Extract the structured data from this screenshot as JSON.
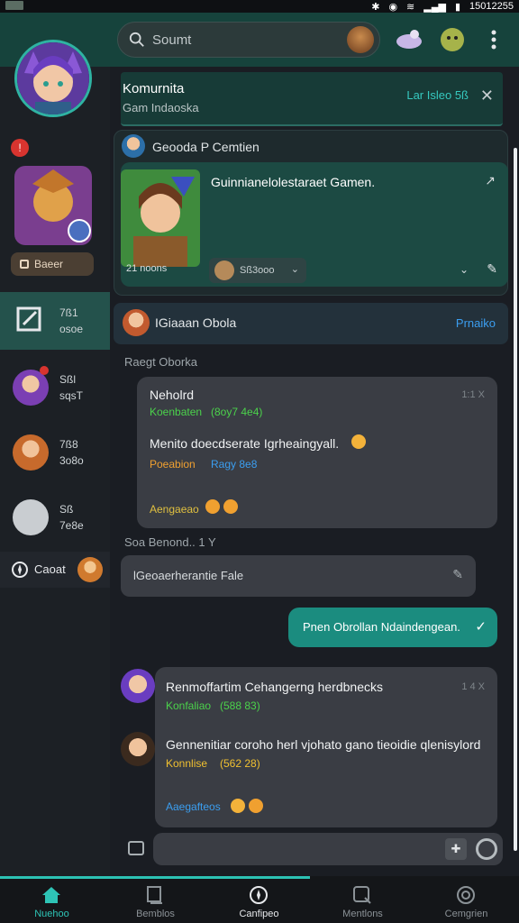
{
  "status": {
    "time": "15012255"
  },
  "search": {
    "placeholder": "Soumt"
  },
  "banner": {
    "title": "Komurnita",
    "subtitle": "Gam Indaoska",
    "link": "Lar Isleo 5ß"
  },
  "card": {
    "author": "Geooda P Cemtien",
    "title": "Guinnianelolestaraet Gamen.",
    "meta": "21 noons",
    "dropdown": "Sß3ooo"
  },
  "pinned": {
    "name": "IGiaaan Obola",
    "action": "Prnaiko"
  },
  "sidebar": {
    "stream_label": "Baeer",
    "items": [
      {
        "line1": "7ß1",
        "line2": "osoe"
      },
      {
        "line1": "Sßl",
        "line2": "sqsT"
      },
      {
        "line1": "7ß8",
        "line2": "3o8o"
      },
      {
        "line1": "Sß",
        "line2": "7e8e"
      }
    ],
    "section_label": "Caoat"
  },
  "messages": {
    "group1_header": "Raegt Oborka",
    "msg1": {
      "title": "Neholrd",
      "time": "1:1 X",
      "sub1": "Koenbaten",
      "sub1b": "(8oy7 4e4)",
      "body": "Menito doecdserate Igrheaingyall.",
      "sub2": "Poeabion",
      "sub2b": "Ragy 8e8",
      "footer": "Aengaeao"
    },
    "group2_header": "Soa Benond.. 1 Y",
    "reply": "lGeoaerherantie Fale",
    "own": "Pnen Obrollan Ndaindengean.",
    "msg2": {
      "title": "Renmoffartim Cehangerng herdbnecks",
      "time": "1 4 X",
      "sub1": "Konfaliao",
      "sub1b": "(588 83)",
      "body": "Gennenitiar coroho herl vjohato gano tieoidie qlenisylord",
      "sub2": "Konnlise",
      "sub2b": "(562 28)",
      "footer": "Aaegafteos"
    }
  },
  "tabs": [
    {
      "label": "Nuehoo"
    },
    {
      "label": "Bemblos"
    },
    {
      "label": "Canfipeo"
    },
    {
      "label": "Mentlons"
    },
    {
      "label": "Cemgrien"
    }
  ],
  "colors": {
    "accent": "#2cc2b4",
    "topbar": "#16433c",
    "bg": "#1a1d23",
    "bubble": "#3a3d44",
    "own_bubble": "#1b8c7f"
  }
}
